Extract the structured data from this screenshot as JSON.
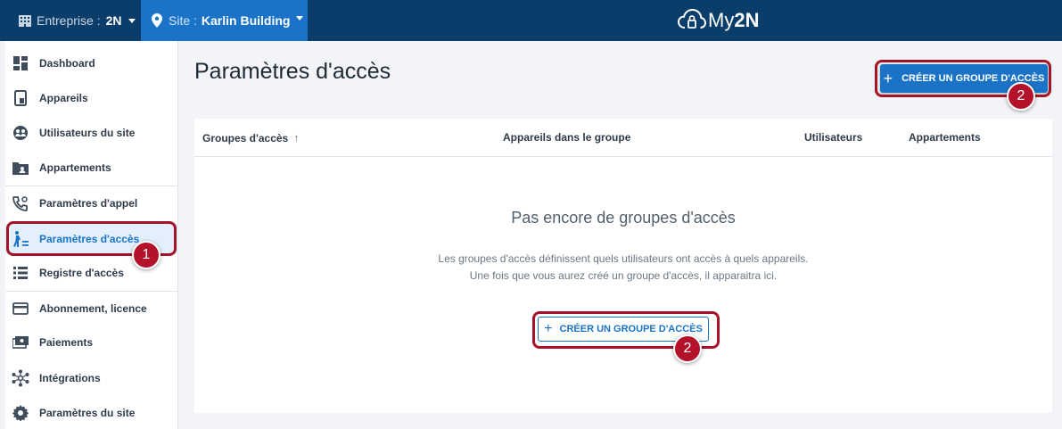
{
  "topbar": {
    "company_label": "Entreprise :",
    "company_value": "2N",
    "site_label": "Site :",
    "site_value": "Karlin Building",
    "logo_prefix": "My",
    "logo_suffix": "2N"
  },
  "sidebar": {
    "items": [
      {
        "label": "Dashboard",
        "icon": "dashboard-icon"
      },
      {
        "label": "Appareils",
        "icon": "device-icon"
      },
      {
        "label": "Utilisateurs du site",
        "icon": "users-globe-icon"
      },
      {
        "label": "Appartements",
        "icon": "apartment-folder-icon"
      },
      {
        "label": "Paramètres d'appel",
        "icon": "phone-settings-icon"
      },
      {
        "label": "Paramètres d'accès",
        "icon": "access-person-icon"
      },
      {
        "label": "Registre d'accès",
        "icon": "list-icon"
      },
      {
        "label": "Abonnement, licence",
        "icon": "credit-card-icon"
      },
      {
        "label": "Paiements",
        "icon": "payment-icon"
      },
      {
        "label": "Intégrations",
        "icon": "integrations-icon"
      },
      {
        "label": "Paramètres du site",
        "icon": "gear-icon"
      }
    ],
    "active_index": 5
  },
  "main": {
    "title": "Paramètres d'accès",
    "create_button": "CRÉER UN GROUPE D'ACCÈS",
    "table": {
      "columns": [
        "Groupes d'accès",
        "Appareils dans le groupe",
        "Utilisateurs",
        "Appartements"
      ],
      "sort_column": 0
    },
    "empty": {
      "title": "Pas encore de groupes d'accès",
      "line1": "Les groupes d'accès définissent quels utilisateurs ont accès à quels appareils.",
      "line2": "Une fois que vous aurez créé un groupe d'accès, il apparaitra ici.",
      "button": "CRÉER UN GROUPE D'ACCÈS"
    }
  },
  "callouts": [
    "1",
    "2",
    "2"
  ],
  "colors": {
    "topbar": "#0b3d6b",
    "site_selector": "#1a73c7",
    "primary": "#1a73c7",
    "callout": "#a5132a"
  }
}
